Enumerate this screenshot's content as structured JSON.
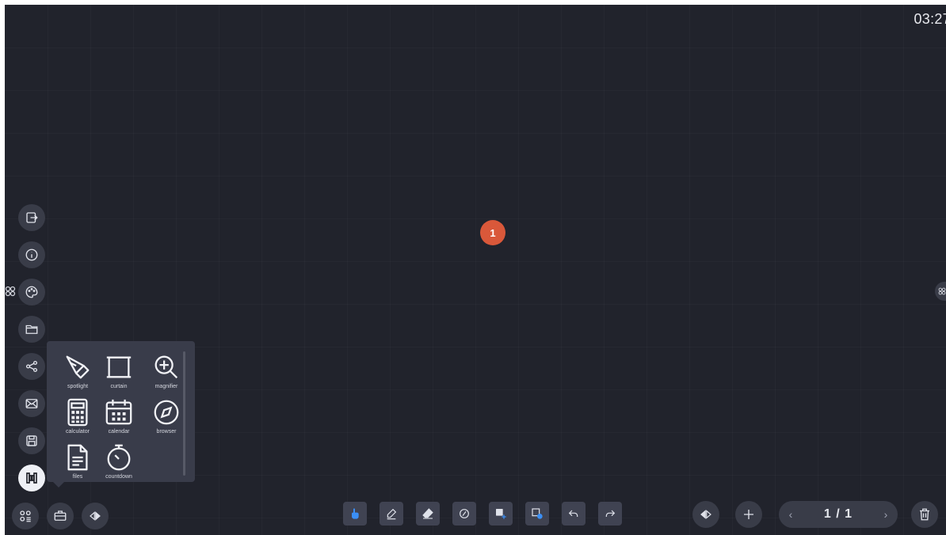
{
  "clock": "03:27",
  "canvas": {
    "page_marker": "1"
  },
  "sidebar": {
    "items": [
      {
        "name": "exit",
        "icon": "exit-icon"
      },
      {
        "name": "info",
        "icon": "info-icon"
      },
      {
        "name": "theme",
        "icon": "palette-icon"
      },
      {
        "name": "open-file",
        "icon": "folder-icon"
      },
      {
        "name": "share",
        "icon": "share-icon"
      },
      {
        "name": "email",
        "icon": "mail-icon"
      },
      {
        "name": "save",
        "icon": "save-icon"
      },
      {
        "name": "toolbox",
        "icon": "toolbox-icon"
      }
    ]
  },
  "tools_popup": {
    "tools": [
      {
        "label": "spotlight",
        "icon": "spotlight-icon"
      },
      {
        "label": "curtain",
        "icon": "curtain-icon"
      },
      {
        "label": "magnifier",
        "icon": "magnifier-icon"
      },
      {
        "label": "calculator",
        "icon": "calculator-icon"
      },
      {
        "label": "calendar",
        "icon": "calendar-icon"
      },
      {
        "label": "browser",
        "icon": "compass-icon"
      },
      {
        "label": "files",
        "icon": "file-icon"
      },
      {
        "label": "countdown",
        "icon": "timer-icon"
      }
    ]
  },
  "bottom_left": {
    "buttons": [
      {
        "name": "apps",
        "icon": "apps-icon"
      },
      {
        "name": "toolbox",
        "icon": "briefcase-icon"
      },
      {
        "name": "mirror",
        "icon": "mirror-icon"
      }
    ]
  },
  "center_toolbar": {
    "tools": [
      {
        "name": "select",
        "icon": "hand-pointer-icon",
        "active": true
      },
      {
        "name": "pen",
        "icon": "pen-icon"
      },
      {
        "name": "eraser",
        "icon": "eraser-icon"
      },
      {
        "name": "shape",
        "icon": "shape-icon"
      },
      {
        "name": "insert-image",
        "icon": "image-icon"
      },
      {
        "name": "insert-shape",
        "icon": "screen-shape-icon"
      },
      {
        "name": "undo",
        "icon": "undo-icon"
      },
      {
        "name": "redo",
        "icon": "redo-icon"
      }
    ]
  },
  "pager": {
    "current": "1 / 1",
    "prev": "‹",
    "next": "›"
  },
  "bottom_right": {
    "mirror_icon": "mirror-icon",
    "add_icon": "plus-icon",
    "delete_icon": "trash-icon"
  },
  "colors": {
    "background": "#21232c",
    "button": "#393c48",
    "accent": "#3b8ff5",
    "marker": "#d9583a"
  }
}
